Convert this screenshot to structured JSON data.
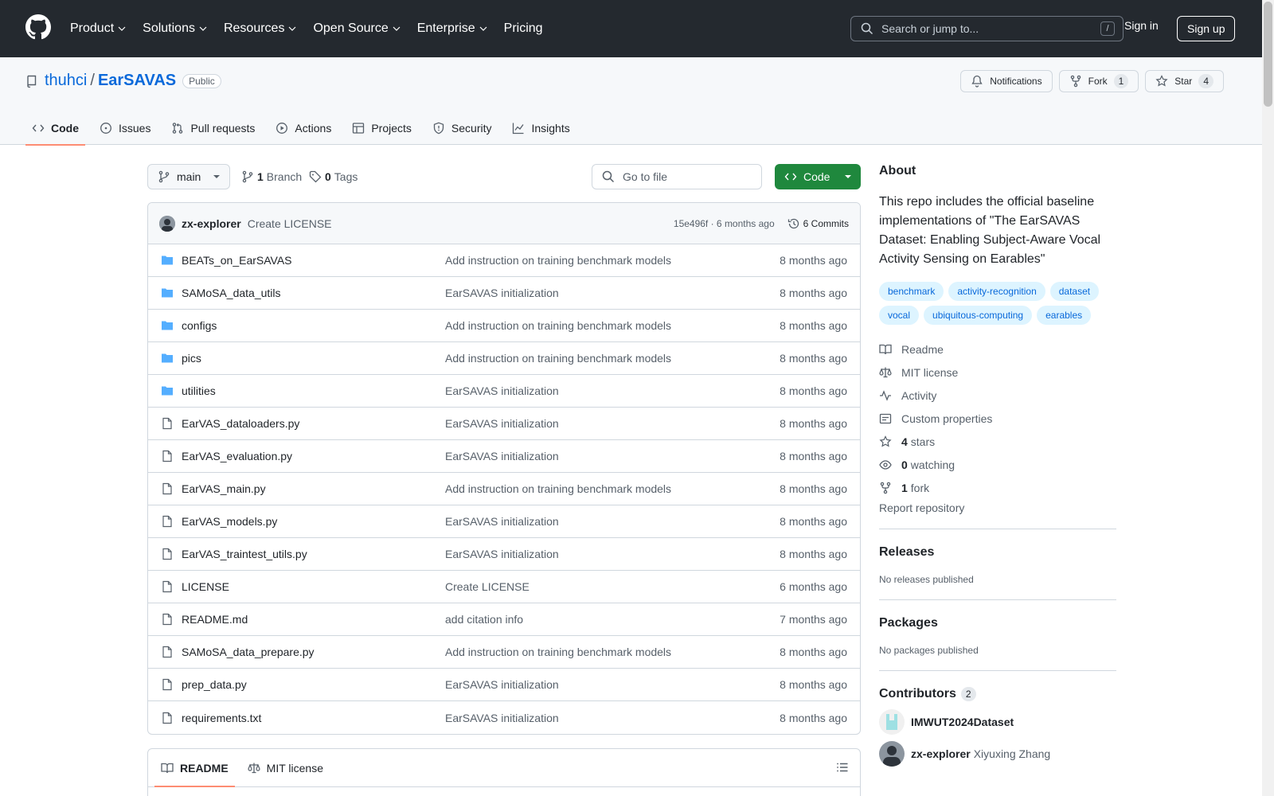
{
  "header": {
    "nav": [
      {
        "label": "Product",
        "dropdown": true
      },
      {
        "label": "Solutions",
        "dropdown": true
      },
      {
        "label": "Resources",
        "dropdown": true
      },
      {
        "label": "Open Source",
        "dropdown": true
      },
      {
        "label": "Enterprise",
        "dropdown": true
      },
      {
        "label": "Pricing",
        "dropdown": false
      }
    ],
    "search_placeholder": "Search or jump to...",
    "search_shortcut": "/",
    "sign_in": "Sign in",
    "sign_up": "Sign up"
  },
  "repo": {
    "owner": "thuhci",
    "separator": "/",
    "name": "EarSAVAS",
    "visibility": "Public",
    "notifications_label": "Notifications",
    "fork_label": "Fork",
    "fork_count": "1",
    "star_label": "Star",
    "star_count": "4"
  },
  "repo_nav": [
    {
      "label": "Code",
      "icon": "code-icon",
      "active": true
    },
    {
      "label": "Issues",
      "icon": "issue-icon",
      "active": false
    },
    {
      "label": "Pull requests",
      "icon": "pull-request-icon",
      "active": false
    },
    {
      "label": "Actions",
      "icon": "play-icon",
      "active": false
    },
    {
      "label": "Projects",
      "icon": "table-icon",
      "active": false
    },
    {
      "label": "Security",
      "icon": "shield-icon",
      "active": false
    },
    {
      "label": "Insights",
      "icon": "graph-icon",
      "active": false
    }
  ],
  "toolbar": {
    "branch": "main",
    "branch_count": "1",
    "branch_label": "Branch",
    "tag_count": "0",
    "tag_label": "Tags",
    "goto_placeholder": "Go to file",
    "code_button": "Code"
  },
  "latest_commit": {
    "author": "zx-explorer",
    "message": "Create LICENSE",
    "sha_time": "15e496f · 6 months ago",
    "commits": "6 Commits"
  },
  "files": [
    {
      "name": "BEATs_on_EarSAVAS",
      "type": "folder",
      "message": "Add instruction on training benchmark models",
      "date": "8 months ago"
    },
    {
      "name": "SAMoSA_data_utils",
      "type": "folder",
      "message": "EarSAVAS initialization",
      "date": "8 months ago"
    },
    {
      "name": "configs",
      "type": "folder",
      "message": "Add instruction on training benchmark models",
      "date": "8 months ago"
    },
    {
      "name": "pics",
      "type": "folder",
      "message": "Add instruction on training benchmark models",
      "date": "8 months ago"
    },
    {
      "name": "utilities",
      "type": "folder",
      "message": "EarSAVAS initialization",
      "date": "8 months ago"
    },
    {
      "name": "EarVAS_dataloaders.py",
      "type": "file",
      "message": "EarSAVAS initialization",
      "date": "8 months ago"
    },
    {
      "name": "EarVAS_evaluation.py",
      "type": "file",
      "message": "EarSAVAS initialization",
      "date": "8 months ago"
    },
    {
      "name": "EarVAS_main.py",
      "type": "file",
      "message": "Add instruction on training benchmark models",
      "date": "8 months ago"
    },
    {
      "name": "EarVAS_models.py",
      "type": "file",
      "message": "EarSAVAS initialization",
      "date": "8 months ago"
    },
    {
      "name": "EarVAS_traintest_utils.py",
      "type": "file",
      "message": "EarSAVAS initialization",
      "date": "8 months ago"
    },
    {
      "name": "LICENSE",
      "type": "file",
      "message": "Create LICENSE",
      "date": "6 months ago"
    },
    {
      "name": "README.md",
      "type": "file",
      "message": "add citation info",
      "date": "7 months ago"
    },
    {
      "name": "SAMoSA_data_prepare.py",
      "type": "file",
      "message": "Add instruction on training benchmark models",
      "date": "8 months ago"
    },
    {
      "name": "prep_data.py",
      "type": "file",
      "message": "EarSAVAS initialization",
      "date": "8 months ago"
    },
    {
      "name": "requirements.txt",
      "type": "file",
      "message": "EarSAVAS initialization",
      "date": "8 months ago"
    }
  ],
  "readme_tabs": {
    "readme": "README",
    "license": "MIT license"
  },
  "about": {
    "title": "About",
    "description": "This repo includes the official baseline implementations of \"The EarSAVAS Dataset: Enabling Subject-Aware Vocal Activity Sensing on Earables\"",
    "topics": [
      "benchmark",
      "activity-recognition",
      "dataset",
      "vocal",
      "ubiquitous-computing",
      "earables"
    ],
    "readme": "Readme",
    "license": "MIT license",
    "activity": "Activity",
    "custom_properties": "Custom properties",
    "stars_count": "4",
    "stars_label": "stars",
    "watching_count": "0",
    "watching_label": "watching",
    "fork_count": "1",
    "fork_label": "fork",
    "report": "Report repository"
  },
  "releases": {
    "title": "Releases",
    "empty": "No releases published"
  },
  "packages": {
    "title": "Packages",
    "empty": "No packages published"
  },
  "contributors": {
    "title": "Contributors",
    "count": "2",
    "list": [
      {
        "login": "IMWUT2024Dataset",
        "name": ""
      },
      {
        "login": "zx-explorer",
        "name": "Xiyuxing Zhang"
      }
    ]
  },
  "colors": {
    "accent": "#0969da",
    "header_bg": "#24292f",
    "code_button": "#1f883d",
    "active_tab": "#fd8c73",
    "folder": "#54aeff"
  }
}
